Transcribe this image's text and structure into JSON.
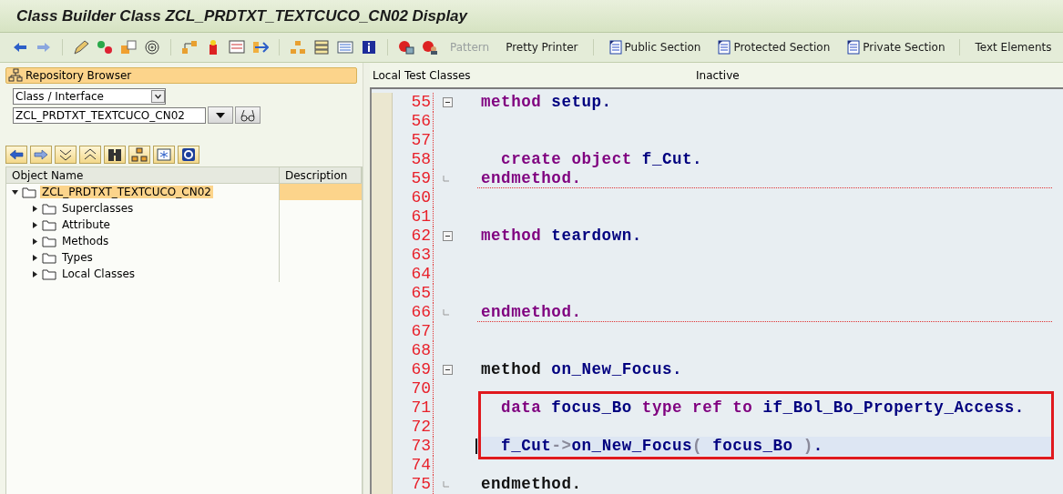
{
  "window": {
    "title": "Class Builder Class ZCL_PRDTXT_TEXTCUCO_CN02 Display"
  },
  "toolbar": {
    "text_buttons": [
      {
        "label": "Pattern",
        "kind": "plain",
        "disabled": true
      },
      {
        "label": "Pretty Printer",
        "kind": "plain",
        "disabled": false
      },
      {
        "label": "Public Section",
        "kind": "doc",
        "disabled": false
      },
      {
        "label": "Protected Section",
        "kind": "doc",
        "disabled": false
      },
      {
        "label": "Private Section",
        "kind": "doc",
        "disabled": false
      },
      {
        "label": "Text Elements",
        "kind": "plain",
        "disabled": false
      }
    ]
  },
  "sidebar": {
    "title": "Repository Browser",
    "object_type": "Class / Interface",
    "object_name": "ZCL_PRDTXT_TEXTCUCO_CN02",
    "tree": {
      "columns": [
        "Object Name",
        "Description"
      ],
      "items": [
        {
          "label": "ZCL_PRDTXT_TEXTCUCO_CN02",
          "expanded": true,
          "selected": true,
          "children": [
            {
              "label": "Superclasses",
              "expanded": false,
              "selected": false
            },
            {
              "label": "Attribute",
              "expanded": false,
              "selected": false
            },
            {
              "label": "Methods",
              "expanded": false,
              "selected": false
            },
            {
              "label": "Types",
              "expanded": false,
              "selected": false
            },
            {
              "label": "Local Classes",
              "expanded": false,
              "selected": false
            }
          ]
        }
      ]
    }
  },
  "editor": {
    "tab": "Local Test Classes",
    "status": "Inactive",
    "lines_before": [
      {
        "number": "55",
        "kind": "block-start",
        "separator": false,
        "current": false,
        "tokens": [
          {
            "kind": "keyword",
            "text": "method"
          },
          {
            "kind": "name",
            "text": " setup."
          }
        ]
      },
      {
        "number": "56",
        "separator": false,
        "current": false
      },
      {
        "number": "57",
        "separator": false,
        "current": false
      },
      {
        "number": "58",
        "separator": false,
        "current": false,
        "tokens": [
          {
            "kind": "keyword",
            "text": "  create object"
          },
          {
            "kind": "name",
            "text": " f_Cut."
          }
        ]
      },
      {
        "number": "59",
        "kind": "block-end",
        "separator": true,
        "current": false,
        "tokens": [
          {
            "kind": "keyword",
            "text": "endmethod."
          }
        ]
      },
      {
        "number": "60",
        "separator": false,
        "current": false
      },
      {
        "number": "61",
        "separator": false,
        "current": false
      },
      {
        "number": "62",
        "kind": "block-start",
        "separator": false,
        "current": false,
        "tokens": [
          {
            "kind": "keyword",
            "text": "method"
          },
          {
            "kind": "name",
            "text": " teardown."
          }
        ]
      },
      {
        "number": "63",
        "separator": false,
        "current": false
      },
      {
        "number": "64",
        "separator": false,
        "current": false
      },
      {
        "number": "65",
        "separator": false,
        "current": false
      },
      {
        "number": "66",
        "kind": "block-end",
        "separator": true,
        "current": false,
        "tokens": [
          {
            "kind": "keyword",
            "text": "endmethod."
          }
        ]
      },
      {
        "number": "67",
        "separator": false,
        "current": false
      },
      {
        "number": "68",
        "separator": false,
        "current": false
      },
      {
        "number": "69",
        "kind": "block-start",
        "separator": false,
        "current": false,
        "tokens": [
          {
            "kind": "plain",
            "text": "method"
          },
          {
            "kind": "name",
            "text": " on_New_Focus."
          }
        ]
      },
      {
        "number": "70",
        "separator": false,
        "current": false
      }
    ],
    "highlight_box": {
      "lines": [
        {
          "number": "71",
          "separator": false,
          "current": false,
          "tokens": [
            {
              "kind": "keyword",
              "text": "  data"
            },
            {
              "kind": "name",
              "text": " focus_Bo "
            },
            {
              "kind": "keyword",
              "text": "type ref to"
            },
            {
              "kind": "name",
              "text": " if_Bol_Bo_Property_Access."
            }
          ]
        },
        {
          "number": "72",
          "separator": false,
          "current": false
        },
        {
          "number": "73",
          "separator": false,
          "current": true,
          "tokens": [
            {
              "kind": "name",
              "text": "  f_Cut"
            },
            {
              "kind": "operator",
              "text": "->"
            },
            {
              "kind": "name",
              "text": "on_New_Focus"
            },
            {
              "kind": "operator",
              "text": "( "
            },
            {
              "kind": "name",
              "text": "focus_Bo"
            },
            {
              "kind": "operator",
              "text": " )"
            },
            {
              "kind": "name",
              "text": "."
            }
          ]
        }
      ]
    },
    "lines_after": [
      {
        "number": "74",
        "separator": false,
        "current": false
      },
      {
        "number": "75",
        "kind": "block-end",
        "separator": false,
        "current": false,
        "tokens": [
          {
            "kind": "plain",
            "text": "endmethod."
          }
        ]
      }
    ]
  }
}
